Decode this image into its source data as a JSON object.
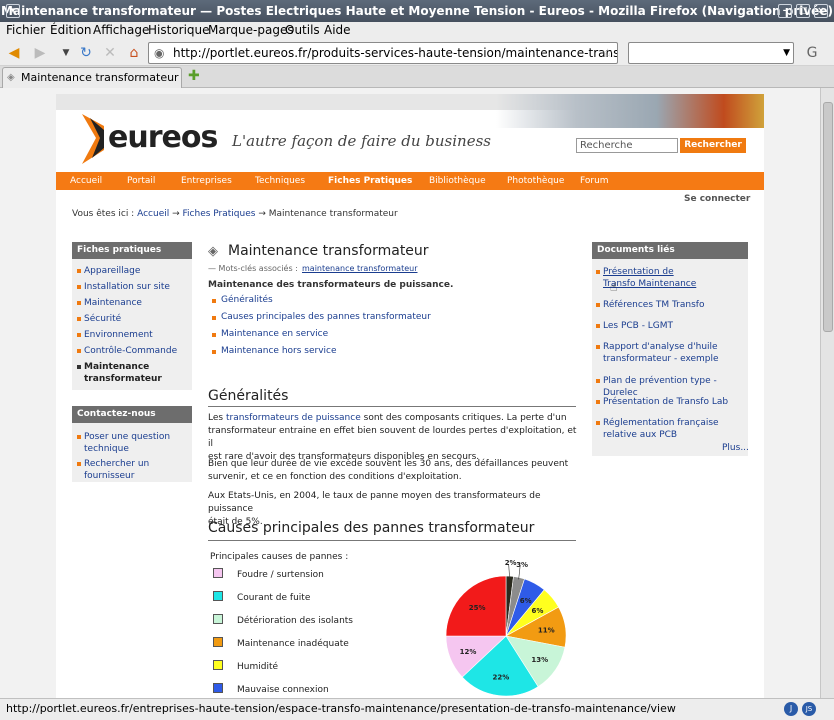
{
  "browser": {
    "window_title": "Maintenance transformateur — Postes Electriques Haute et Moyenne Tension - Eureos - Mozilla Firefox (Navigation privée)",
    "menu": [
      "Fichier",
      "Édition",
      "Affichage",
      "Historique",
      "Marque-pages",
      "Outils",
      "Aide"
    ],
    "url": "http://portlet.eureos.fr/produits-services-haute-tension/maintenance-transformateur/view",
    "tab_title": "Maintenance transformateur — ...",
    "status_url": "http://portlet.eureos.fr/entreprises-haute-tension/espace-transfo-maintenance/presentation-de-transfo-maintenance/view"
  },
  "site": {
    "logo_text": "eureos",
    "tagline": "L'autre façon de faire du business",
    "search_placeholder": "Recherche",
    "search_button": "Rechercher",
    "nav": [
      "Accueil",
      "Portail",
      "Entreprises",
      "Techniques",
      "Fiches Pratiques",
      "Bibliothèque",
      "Photothèque",
      "Forum"
    ],
    "active_nav": "Fiches Pratiques",
    "connect": "Se connecter",
    "breadcrumb": {
      "prefix": "Vous êtes ici :",
      "items": [
        "Accueil",
        "Fiches Pratiques",
        "Maintenance transformateur"
      ],
      "sep": "→"
    }
  },
  "left": {
    "fiches_title": "Fiches pratiques",
    "fiches": [
      "Appareillage",
      "Installation sur site",
      "Maintenance",
      "Sécurité",
      "Environnement",
      "Contrôle-Commande",
      "Maintenance transformateur"
    ],
    "contact_title": "Contactez-nous",
    "contact": [
      "Poser une question technique",
      "Rechercher un fournisseur"
    ]
  },
  "right": {
    "title": "Documents liés",
    "docs": [
      "Présentation de Transfo Maintenance",
      "Références TM Transfo",
      "Les PCB - LGMT",
      "Rapport d'analyse d'huile transformateur - exemple",
      "Plan de prévention type - Durelec",
      "Présentation de Transfo Lab",
      "Réglementation française relative aux PCB"
    ],
    "more": "Plus..."
  },
  "main": {
    "title": "Maintenance transformateur",
    "keywords_label": "— Mots-clés associés :",
    "keywords_link": "maintenance transformateur",
    "subtitle": "Maintenance des transformateurs de puissance.",
    "toc": [
      "Généralités",
      "Causes principales des pannes transformateur",
      "Maintenance en service",
      "Maintenance hors service"
    ],
    "h_generalites": "Généralités",
    "p1_link": "transformateurs de puissance",
    "p1_a": "Les",
    "p1_b": "sont des composants critiques. La perte d'un",
    "p1_c": "transformateur entraine en effet bien souvent de lourdes pertes d'exploitation, et il",
    "p1_d": "est rare d'avoir des transformateurs disponibles en secours.",
    "p2_a": "Bien que leur durée de vie excède souvent les 30 ans, des défaillances peuvent",
    "p2_b": "survenir, et ce en fonction des conditions d'exploitation.",
    "p3_a": "Aux Etats-Unis, en 2004, le taux de panne moyen des transformateurs de puissance",
    "p3_b": "était de 5%.",
    "h_causes": "Causes principales des pannes transformateur",
    "legend_title": "Principales causes de pannes :",
    "legend": [
      "Foudre / surtension",
      "Courant de fuite",
      "Détérioration  des isolants",
      "Maintenance inadéquate",
      "Humidité",
      "Mauvaise connexion"
    ]
  },
  "chart_data": {
    "type": "pie",
    "slices": [
      {
        "label": "2%",
        "value": 2,
        "color": "#2a2a1e"
      },
      {
        "label": "3%",
        "value": 3,
        "color": "#8c8c8c"
      },
      {
        "label": "6%",
        "value": 6,
        "color": "#2f5be8"
      },
      {
        "label": "6%",
        "value": 6,
        "color": "#ffff1e"
      },
      {
        "label": "11%",
        "value": 11,
        "color": "#f29b12"
      },
      {
        "label": "13%",
        "value": 13,
        "color": "#c8f5d8"
      },
      {
        "label": "22%",
        "value": 22,
        "color": "#1ee6e6"
      },
      {
        "label": "12%",
        "value": 12,
        "color": "#f5c6f0"
      },
      {
        "label": "25%",
        "value": 25,
        "color": "#f21a1a"
      }
    ],
    "legend_colors": [
      "#f5c6f0",
      "#1ee6e6",
      "#c8f5d8",
      "#f29b12",
      "#ffff1e",
      "#2f5be8",
      "#2a2a1e"
    ]
  }
}
